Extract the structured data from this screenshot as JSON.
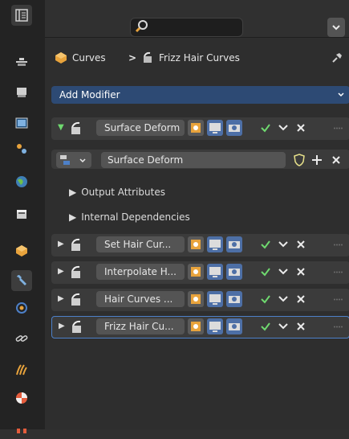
{
  "topbar": {
    "search_placeholder": "",
    "dropdown_icon": "chevron-down-icon"
  },
  "breadcrumb": {
    "object": "Curves",
    "separator": ">",
    "modifier_context": "Frizz Hair Curves"
  },
  "add_modifier": {
    "label": "Add Modifier"
  },
  "modifiers": [
    {
      "name": "Surface Deform",
      "expanded": true,
      "selected": false
    },
    {
      "name": "Set Hair Cur...",
      "expanded": false,
      "selected": false
    },
    {
      "name": "Interpolate H...",
      "expanded": false,
      "selected": false
    },
    {
      "name": "Hair Curves ...",
      "expanded": false,
      "selected": false
    },
    {
      "name": "Frizz Hair Cu...",
      "expanded": false,
      "selected": true
    }
  ],
  "surface_deform_panel": {
    "node_group": "Surface Deform",
    "sections": [
      "Output Attributes",
      "Internal Dependencies"
    ]
  },
  "colors": {
    "accent_blue": "#4d80c8",
    "check_green": "#6fd96f",
    "object_orange": "#e8a33c"
  }
}
